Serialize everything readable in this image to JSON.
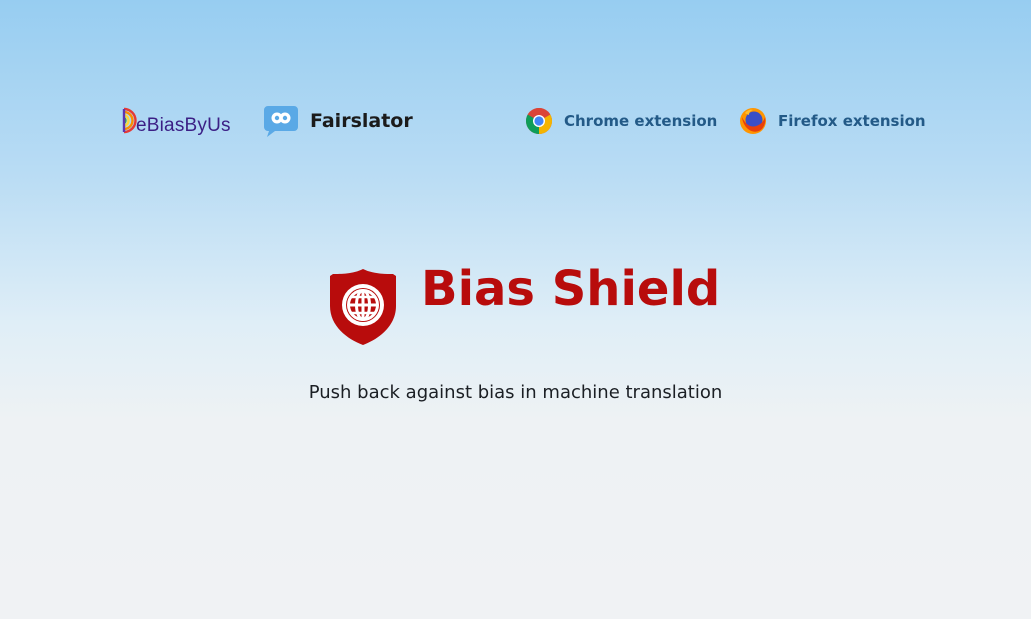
{
  "nav": {
    "debias": {
      "label": "DeBiasByUs",
      "text_after_logo": "eBiasByUs"
    },
    "fairslator": {
      "label": "Fairslator"
    },
    "chrome": {
      "label": "Chrome extension"
    },
    "firefox": {
      "label": "Firefox extension"
    }
  },
  "hero": {
    "title": "Bias Shield",
    "tagline": "Push back against bias in machine translation"
  },
  "colors": {
    "brand_red": "#b80c0c",
    "link_blue": "#235a87",
    "debias_purple": "#3b1f85",
    "fairslator_blue": "#5aa9e6"
  },
  "icons": {
    "debias": "rainbow-d-logo-icon",
    "fairslator": "speech-bubble-logo-icon",
    "chrome": "chrome-icon",
    "firefox": "firefox-icon",
    "shield": "shield-globe-icon"
  }
}
